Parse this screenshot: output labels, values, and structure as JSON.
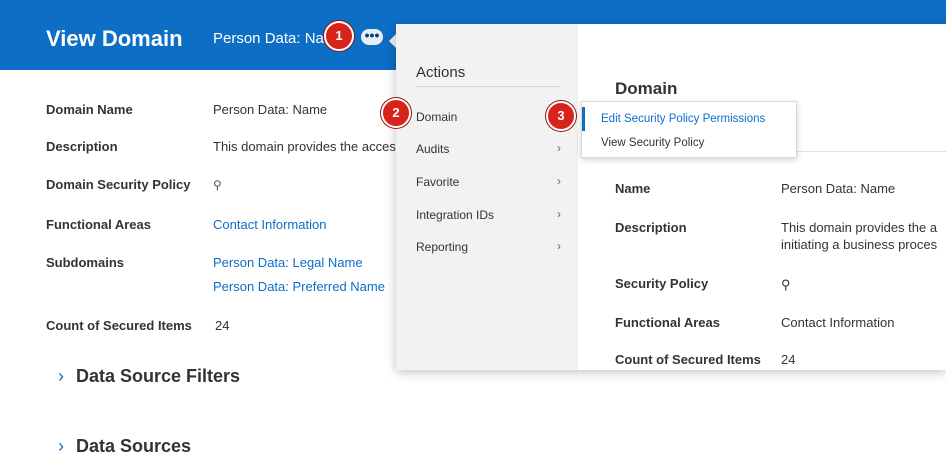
{
  "header": {
    "title": "View Domain",
    "subtitle": "Person Data: Name",
    "more_button_label": "•••"
  },
  "fields": {
    "domain_name": {
      "label": "Domain Name",
      "value": "Person Data:  Name"
    },
    "description": {
      "label": "Description",
      "value": "This domain provides the access"
    },
    "security_policy": {
      "label": "Domain Security Policy",
      "icon": "search-icon"
    },
    "functional_areas": {
      "label": "Functional Areas",
      "value": "Contact Information"
    },
    "subdomains": {
      "label": "Subdomains",
      "values": [
        "Person Data: Legal Name",
        "Person Data: Preferred Name"
      ]
    },
    "count": {
      "label": "Count of Secured Items",
      "value": "24"
    }
  },
  "sections": [
    {
      "label": "Data Source Filters"
    },
    {
      "label": "Data Sources"
    }
  ],
  "actions_panel": {
    "title": "Actions",
    "items": [
      {
        "label": "Domain",
        "has_submenu": false
      },
      {
        "label": "Audits",
        "has_submenu": true
      },
      {
        "label": "Favorite",
        "has_submenu": true
      },
      {
        "label": "Integration IDs",
        "has_submenu": true
      },
      {
        "label": "Reporting",
        "has_submenu": true
      }
    ],
    "arrow_glyph": "›"
  },
  "detail_panel": {
    "title": "Domain",
    "rows": [
      {
        "label": "Name",
        "value": "Person Data:  Name"
      },
      {
        "label": "Description",
        "value": "This domain provides the a",
        "value2": "initiating a business proces"
      },
      {
        "label": "Security Policy",
        "icon": "search-icon"
      },
      {
        "label": "Functional Areas",
        "value": "Contact Information"
      },
      {
        "label": "Count of Secured Items",
        "value": "24"
      }
    ]
  },
  "submenu": {
    "items": [
      {
        "label": "Edit Security Policy Permissions",
        "active": true
      },
      {
        "label": "View Security Policy",
        "active": false
      }
    ]
  },
  "markers": [
    "1",
    "2",
    "3"
  ],
  "colors": {
    "header_bg": "#0d6ec6",
    "link": "#0d6ec6",
    "marker": "#d8231c",
    "actions_bg": "#f2f2f2"
  }
}
